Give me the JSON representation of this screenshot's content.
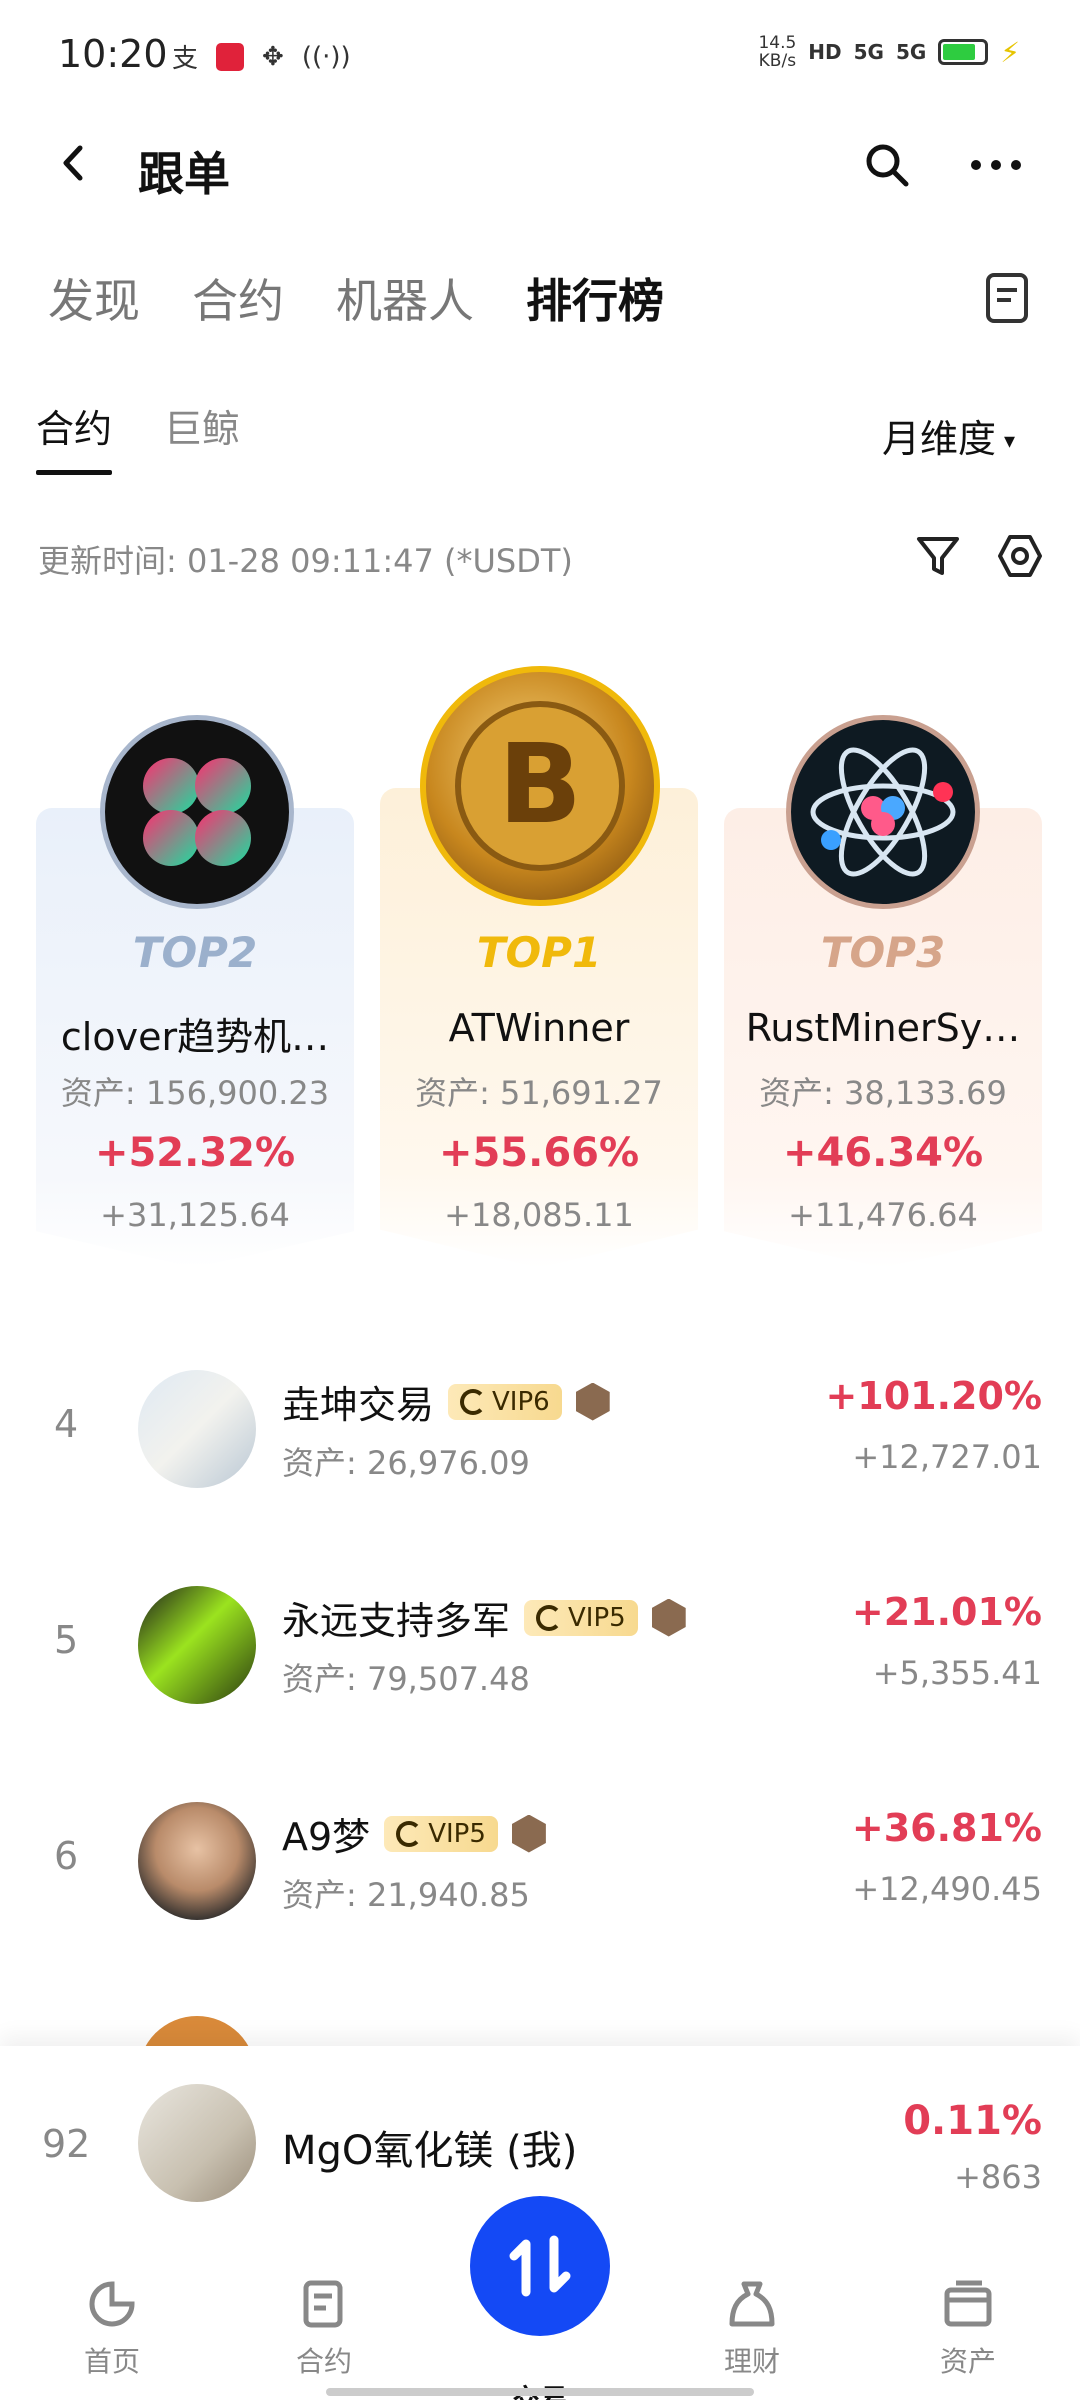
{
  "status_bar": {
    "time": "10:20",
    "net_speed_value": "14.5",
    "net_speed_unit": "KB/s",
    "hd": "HD",
    "signal_1": "5G",
    "signal_2": "5G",
    "battery_level": 0.8
  },
  "header": {
    "title": "跟单"
  },
  "main_tabs": [
    {
      "label": "发现",
      "active": false
    },
    {
      "label": "合约",
      "active": false
    },
    {
      "label": "机器人",
      "active": false
    },
    {
      "label": "排行榜",
      "active": true
    }
  ],
  "sub_tabs": [
    {
      "label": "合约",
      "active": true
    },
    {
      "label": "巨鲸",
      "active": false
    }
  ],
  "dimension": {
    "label": "月维度",
    "caret": "▾"
  },
  "update_time": "更新时间: 01-28 09:11:47 (*USDT)",
  "podium": [
    {
      "rank_label": "TOP2",
      "name": "clover趋势机…",
      "assets": "资产: 156,900.23",
      "pct": "+52.32%",
      "profit": "+31,125.64"
    },
    {
      "rank_label": "TOP1",
      "name": "ATWinner",
      "assets": "资产: 51,691.27",
      "pct": "+55.66%",
      "profit": "+18,085.11"
    },
    {
      "rank_label": "TOP3",
      "name": "RustMinerSy…",
      "assets": "资产: 38,133.69",
      "pct": "+46.34%",
      "profit": "+11,476.64"
    }
  ],
  "list": [
    {
      "rank": "4",
      "name": "垚坤交易",
      "vip": "VIP6",
      "assets": "资产: 26,976.09",
      "pct": "+101.20%",
      "profit": "+12,727.01"
    },
    {
      "rank": "5",
      "name": "永远支持多军",
      "vip": "VIP5",
      "assets": "资产: 79,507.48",
      "pct": "+21.01%",
      "profit": "+5,355.41"
    },
    {
      "rank": "6",
      "name": "A9梦",
      "vip": "VIP5",
      "assets": "资产: 21,940.85",
      "pct": "+36.81%",
      "profit": "+12,490.45"
    }
  ],
  "me": {
    "rank": "92",
    "name": "MgO氧化镁 (我)",
    "pct": "0.11%",
    "profit": "+863"
  },
  "bottom_nav": [
    {
      "label": "首页",
      "icon": "home-icon"
    },
    {
      "label": "合约",
      "icon": "contract-icon"
    },
    {
      "label": "交易",
      "icon": "trade-icon"
    },
    {
      "label": "理财",
      "icon": "finance-icon"
    },
    {
      "label": "资产",
      "icon": "wallet-icon"
    }
  ],
  "colors": {
    "accent": "#1449f5",
    "gain": "#e23d56",
    "gold": "#f0b90b"
  }
}
